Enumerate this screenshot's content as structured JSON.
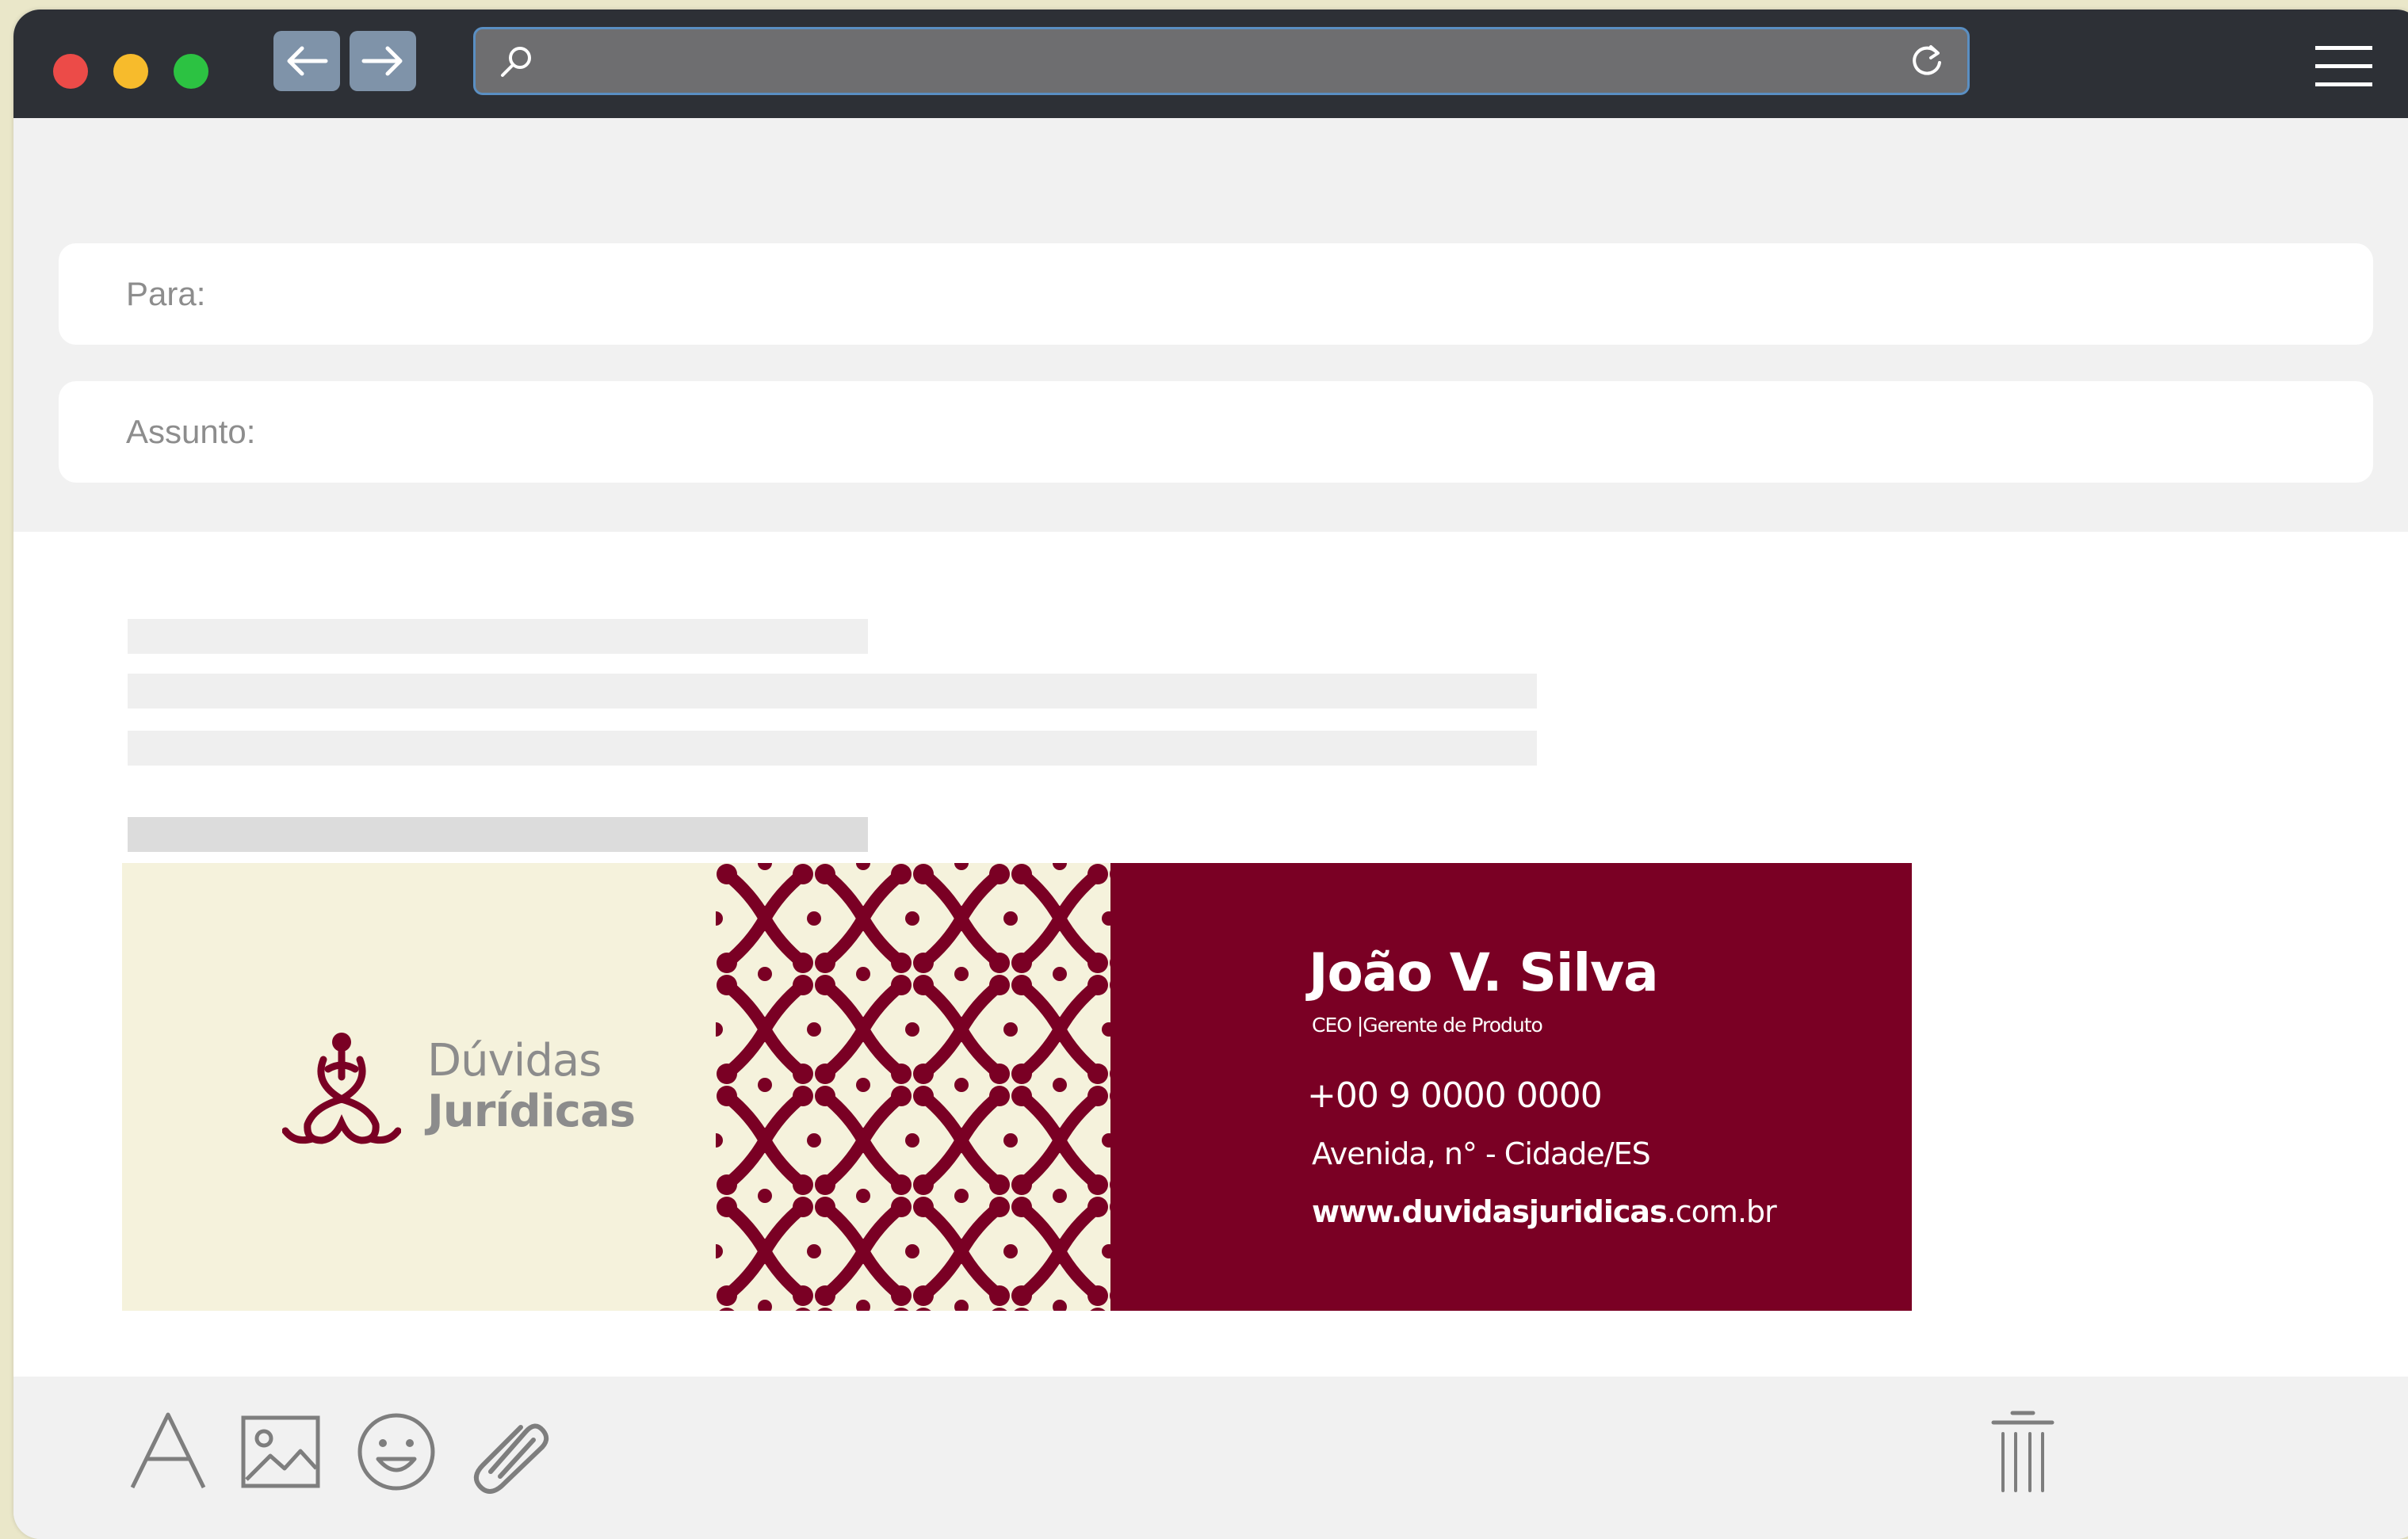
{
  "browser": {
    "back_icon": "arrow-left-icon",
    "forward_icon": "arrow-right-icon",
    "search_icon": "search-icon",
    "reload_icon": "reload-icon",
    "menu_icon": "hamburger-menu-icon",
    "colors": {
      "toolbar": "#2d3036",
      "close": "#ec4b48",
      "minimize": "#f7bb2c",
      "maximize": "#2cc242",
      "nav_button": "#7f93a9",
      "address_bar": "#6e6e70",
      "address_border": "#5a8fc3"
    }
  },
  "compose": {
    "to_label": "Para:",
    "subject_label": "Assunto:"
  },
  "signature": {
    "logo_line1": "Dúvidas",
    "logo_line2": "Jurídicas",
    "name": "João V. Silva",
    "role": "CEO |Gerente de Produto",
    "phone": "+00 9 0000 0000",
    "address": "Avenida, n° - Cidade/ES",
    "website_bold": "www.duvidasjuridicas",
    "website_suffix": ".com.br",
    "colors": {
      "brand": "#7a0024",
      "cream": "#f5f2dc"
    }
  },
  "toolbar_bottom": {
    "icons": [
      "text-format-icon",
      "image-icon",
      "emoji-icon",
      "attachment-icon",
      "trash-icon"
    ]
  }
}
